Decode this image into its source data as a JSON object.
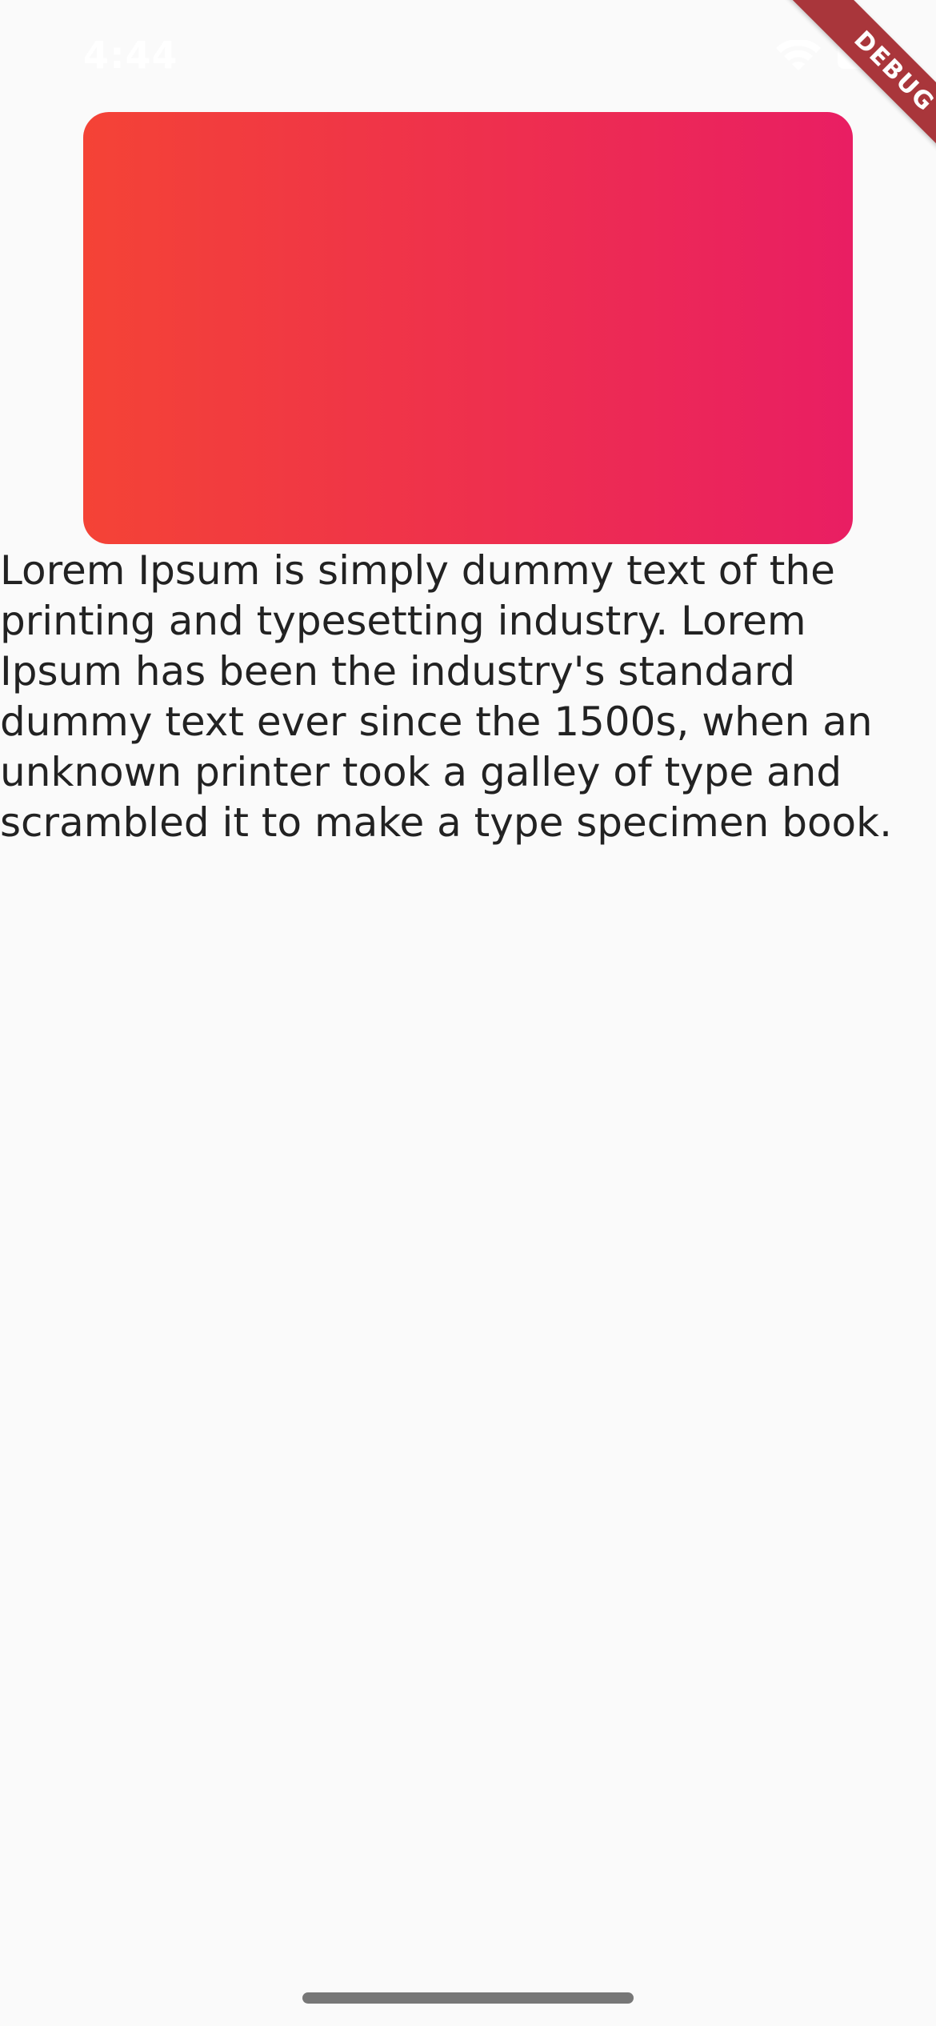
{
  "status_bar": {
    "time": "4:44",
    "wifi_icon": "wifi-icon",
    "battery_icon": "battery-icon"
  },
  "debug_banner": {
    "label": "DEBUG"
  },
  "card": {
    "gradient_start": "#f44336",
    "gradient_end": "#e91e63"
  },
  "body": {
    "text": "Lorem Ipsum is simply dummy text of the printing and typesetting industry. Lorem Ipsum has been the industry's standard dummy text ever since the 1500s, when an unknown printer took a galley of type and scrambled it to make a type specimen book."
  }
}
